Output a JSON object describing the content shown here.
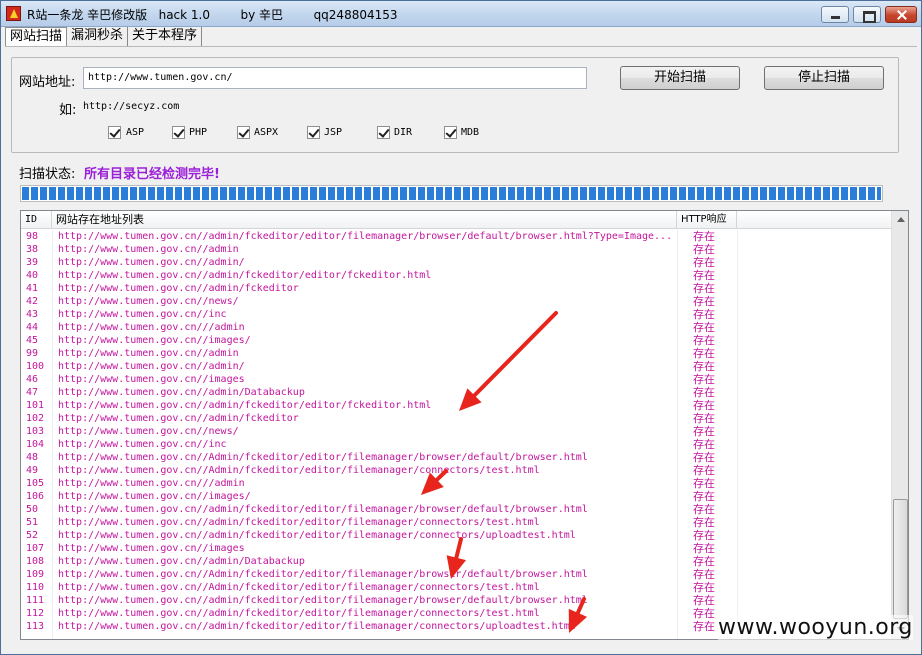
{
  "window": {
    "title": "R站一条龙 辛巴修改版   hack 1.0        by 辛巴        qq248804153"
  },
  "tabs": [
    {
      "label": "网站扫描"
    },
    {
      "label": "漏洞秒杀"
    },
    {
      "label": "关于本程序"
    }
  ],
  "form": {
    "url_label": "网站地址:",
    "url_value": "http://www.tumen.gov.cn/",
    "example_prefix": "如:",
    "example_url": "http://secyz.com",
    "start_button": "开始扫描",
    "stop_button": "停止扫描",
    "checkboxes": [
      {
        "label": "ASP",
        "checked": true
      },
      {
        "label": "PHP",
        "checked": true
      },
      {
        "label": "ASPX",
        "checked": true
      },
      {
        "label": "JSP",
        "checked": true
      },
      {
        "label": "DIR",
        "checked": true
      },
      {
        "label": "MDB",
        "checked": true
      }
    ]
  },
  "status": {
    "label": "扫描状态:",
    "value": "所有目录已经检测完毕!",
    "progress": 1.0
  },
  "colors": {
    "row_text": "#c3159c",
    "status_text": "#9b1fd8",
    "progress": "#2a7dd9",
    "annotation_arrow": "#e8251c"
  },
  "table": {
    "columns": [
      "ID",
      "网站存在地址列表",
      "HTTP响应"
    ],
    "rows": [
      {
        "id": "98",
        "url": "http://www.tumen.gov.cn//admin/fckeditor/editor/filemanager/browser/default/browser.html?Type=Image...",
        "http": "存在"
      },
      {
        "id": "38",
        "url": "http://www.tumen.gov.cn//admin",
        "http": "存在"
      },
      {
        "id": "39",
        "url": "http://www.tumen.gov.cn//admin/",
        "http": "存在"
      },
      {
        "id": "40",
        "url": "http://www.tumen.gov.cn//admin/fckeditor/editor/fckeditor.html",
        "http": "存在"
      },
      {
        "id": "41",
        "url": "http://www.tumen.gov.cn//admin/fckeditor",
        "http": "存在"
      },
      {
        "id": "42",
        "url": "http://www.tumen.gov.cn//news/",
        "http": "存在"
      },
      {
        "id": "43",
        "url": "http://www.tumen.gov.cn//inc",
        "http": "存在"
      },
      {
        "id": "44",
        "url": "http://www.tumen.gov.cn///admin",
        "http": "存在"
      },
      {
        "id": "45",
        "url": "http://www.tumen.gov.cn//images/",
        "http": "存在"
      },
      {
        "id": "99",
        "url": "http://www.tumen.gov.cn//admin",
        "http": "存在"
      },
      {
        "id": "100",
        "url": "http://www.tumen.gov.cn//admin/",
        "http": "存在"
      },
      {
        "id": "46",
        "url": "http://www.tumen.gov.cn//images",
        "http": "存在"
      },
      {
        "id": "47",
        "url": "http://www.tumen.gov.cn//admin/Databackup",
        "http": "存在"
      },
      {
        "id": "101",
        "url": "http://www.tumen.gov.cn//admin/fckeditor/editor/fckeditor.html",
        "http": "存在"
      },
      {
        "id": "102",
        "url": "http://www.tumen.gov.cn//admin/fckeditor",
        "http": "存在"
      },
      {
        "id": "103",
        "url": "http://www.tumen.gov.cn//news/",
        "http": "存在"
      },
      {
        "id": "104",
        "url": "http://www.tumen.gov.cn//inc",
        "http": "存在"
      },
      {
        "id": "48",
        "url": "http://www.tumen.gov.cn//Admin/fckeditor/editor/filemanager/browser/default/browser.html",
        "http": "存在"
      },
      {
        "id": "49",
        "url": "http://www.tumen.gov.cn//Admin/fckeditor/editor/filemanager/connectors/test.html",
        "http": "存在"
      },
      {
        "id": "105",
        "url": "http://www.tumen.gov.cn///admin",
        "http": "存在"
      },
      {
        "id": "106",
        "url": "http://www.tumen.gov.cn//images/",
        "http": "存在"
      },
      {
        "id": "50",
        "url": "http://www.tumen.gov.cn//admin/fckeditor/editor/filemanager/browser/default/browser.html",
        "http": "存在"
      },
      {
        "id": "51",
        "url": "http://www.tumen.gov.cn//admin/fckeditor/editor/filemanager/connectors/test.html",
        "http": "存在"
      },
      {
        "id": "52",
        "url": "http://www.tumen.gov.cn//admin/fckeditor/editor/filemanager/connectors/uploadtest.html",
        "http": "存在"
      },
      {
        "id": "107",
        "url": "http://www.tumen.gov.cn//images",
        "http": "存在"
      },
      {
        "id": "108",
        "url": "http://www.tumen.gov.cn//admin/Databackup",
        "http": "存在"
      },
      {
        "id": "109",
        "url": "http://www.tumen.gov.cn//Admin/fckeditor/editor/filemanager/browser/default/browser.html",
        "http": "存在"
      },
      {
        "id": "110",
        "url": "http://www.tumen.gov.cn//Admin/fckeditor/editor/filemanager/connectors/test.html",
        "http": "存在"
      },
      {
        "id": "111",
        "url": "http://www.tumen.gov.cn//admin/fckeditor/editor/filemanager/browser/default/browser.html",
        "http": "存在"
      },
      {
        "id": "112",
        "url": "http://www.tumen.gov.cn//admin/fckeditor/editor/filemanager/connectors/test.html",
        "http": "存在"
      },
      {
        "id": "113",
        "url": "http://www.tumen.gov.cn//admin/fckeditor/editor/filemanager/connectors/uploadtest.html",
        "http": "存在"
      }
    ]
  },
  "watermark": "www.wooyun.org"
}
